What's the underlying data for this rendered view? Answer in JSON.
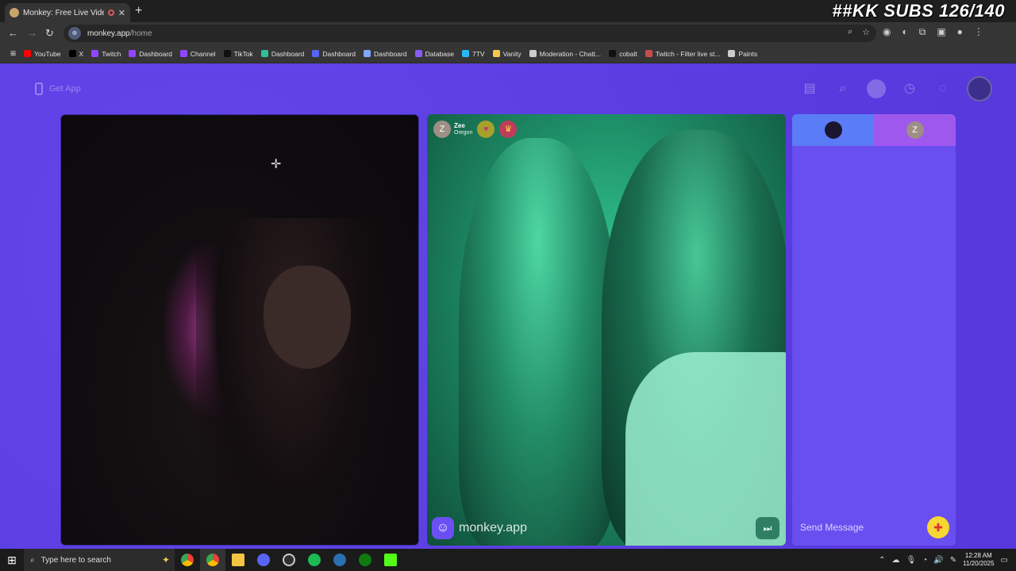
{
  "browser": {
    "tab_title": "Monkey: Free Live Video Ch",
    "tab_close": "✕",
    "new_tab": "+",
    "url_host": "monkey.app",
    "url_path": "/home",
    "site_badge": "⊕"
  },
  "stream_overlay": "##KK SUBS 126/140",
  "bookmarks": [
    {
      "label": "YouTube",
      "color": "#ff0000"
    },
    {
      "label": "X",
      "color": "#000000"
    },
    {
      "label": "Twitch",
      "color": "#9146ff"
    },
    {
      "label": "Dashboard",
      "color": "#9146ff"
    },
    {
      "label": "Channel",
      "color": "#9146ff"
    },
    {
      "label": "TikTok",
      "color": "#111111"
    },
    {
      "label": "Dashboard",
      "color": "#2fbf9b"
    },
    {
      "label": "Dashboard",
      "color": "#5865f2"
    },
    {
      "label": "Dashboard",
      "color": "#7fa7ff"
    },
    {
      "label": "Database",
      "color": "#8a5cf6"
    },
    {
      "label": "7TV",
      "color": "#29b6f6"
    },
    {
      "label": "Vanity",
      "color": "#f2c94c"
    },
    {
      "label": "Moderation - Chatt...",
      "color": "#cccccc"
    },
    {
      "label": "cobalt",
      "color": "#111111"
    },
    {
      "label": "Twitch - Filter live st...",
      "color": "#c94c4c"
    },
    {
      "label": "Paints",
      "color": "#cccccc"
    }
  ],
  "app": {
    "get_app": "Get App",
    "peer": {
      "initial": "Z",
      "name": "Zee",
      "location": "Oregon"
    },
    "watermark": "monkey.app",
    "chat": {
      "other_initial": "Z",
      "placeholder": "Send Message"
    }
  },
  "taskbar": {
    "search_placeholder": "Type here to search",
    "time": "12:28 AM",
    "date": "11/20/2025"
  },
  "colors": {
    "page_bg": "#5b3fe0",
    "chat_tab_left": "#5b7cf7",
    "chat_tab_right": "#9f58ee",
    "gift": "#f7d733"
  }
}
